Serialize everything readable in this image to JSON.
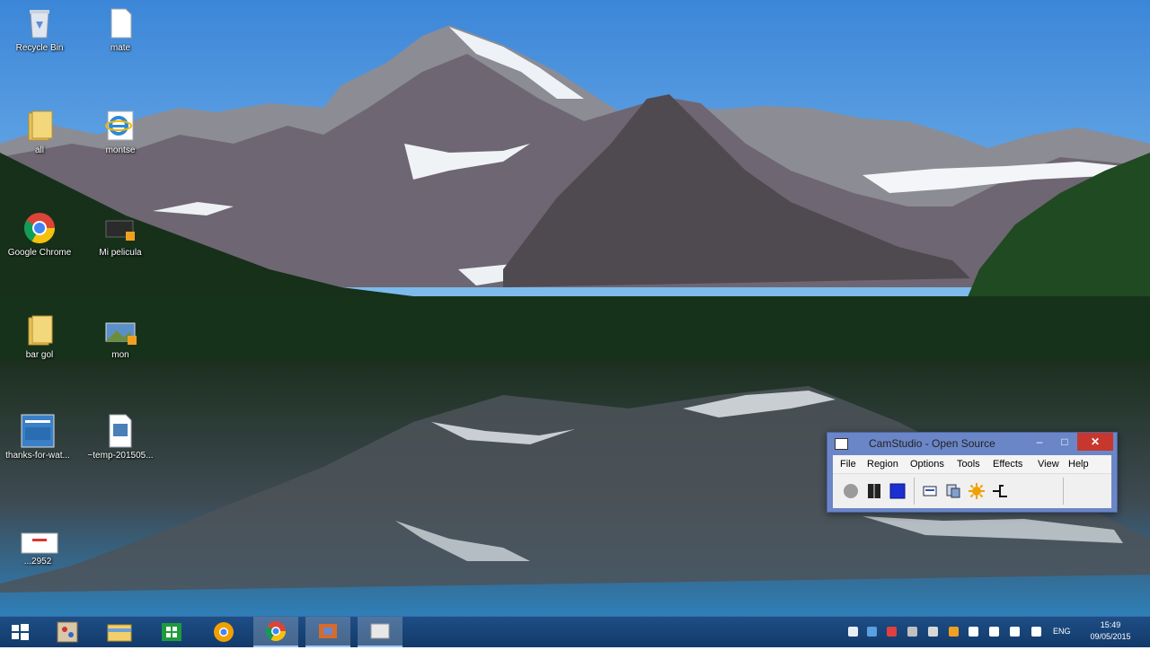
{
  "desktop": {
    "icons": [
      {
        "label": "Recycle Bin",
        "icon": "recycle-bin-icon"
      },
      {
        "label": "mate",
        "icon": "blank-document-icon"
      },
      {
        "label": "all",
        "icon": "folder-icon"
      },
      {
        "label": "montse",
        "icon": "internet-explorer-icon"
      },
      {
        "label": "Google Chrome",
        "icon": "google-chrome-icon"
      },
      {
        "label": "Mi pelicula",
        "icon": "video-file-icon"
      },
      {
        "label": "bar gol",
        "icon": "folder-icon"
      },
      {
        "label": "mon",
        "icon": "image-file-icon"
      },
      {
        "label": "thanks-for-wat...",
        "icon": "image-thumbnail-icon"
      },
      {
        "label": "~temp-201505...",
        "icon": "document-icon"
      },
      {
        "label": "...2952",
        "icon": "document-thumbnail-icon"
      }
    ]
  },
  "camstudio": {
    "title": "CamStudio - Open Source",
    "controls": {
      "minimize": "–",
      "maximize": "□",
      "close": "✕"
    },
    "menu": [
      "File",
      "Region",
      "Options",
      "Tools",
      "Effects",
      "View",
      "Help"
    ],
    "toolbar": [
      {
        "name": "record-button",
        "icon": "record-circle-icon"
      },
      {
        "name": "pause-button",
        "icon": "pause-icon"
      },
      {
        "name": "stop-button",
        "icon": "stop-square-icon"
      },
      {
        "name": "annotation-button",
        "icon": "annotation-icon"
      },
      {
        "name": "region-button",
        "icon": "region-icon"
      },
      {
        "name": "effects-button",
        "icon": "sun-icon"
      },
      {
        "name": "cursor-button",
        "icon": "cursor-settings-icon"
      }
    ]
  },
  "taskbar": {
    "start": "windows-start-icon",
    "apps": [
      "paint-icon",
      "file-explorer-icon",
      "store-icon",
      "chrome-icon",
      "chrome-icon",
      "camstudio-icon",
      "blank-window-icon"
    ],
    "tray_language": "ENG",
    "clock_time": "15:49",
    "clock_date": "09/05/2015"
  }
}
